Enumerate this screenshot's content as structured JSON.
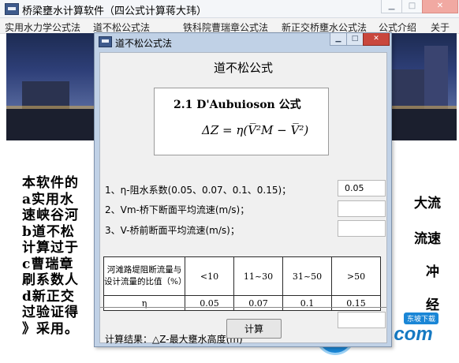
{
  "app": {
    "title": "桥梁壅水计算软件（四公式计算蒋大玮）",
    "menu": [
      "实用水力学公式法",
      "道不松公式法",
      "铁科院曹瑞章公式法",
      "新正交桥壅水公式法",
      "公式介绍",
      "关于"
    ]
  },
  "background": {
    "intro_lines": [
      "本软件的",
      "a实用水",
      "速峡谷河",
      "b道不松",
      "计算过于",
      "c曹瑞章",
      "刷系数人",
      "d新正交",
      "过验证得",
      "》采用。"
    ],
    "right_fragments": [
      "大流",
      "流速",
      "冲",
      "经"
    ]
  },
  "watermark": {
    "text": "uzzf.com",
    "badge": "东坡下载"
  },
  "dialog": {
    "title": "道不松公式法",
    "heading": "道不松公式",
    "formula_title": "2.1  D'Aubuioson 公式",
    "formula": "ΔZ = η(V̅²M − V̅²)",
    "params": [
      {
        "label": "1、η-阻水系数(0.05、0.07、0.1、0.15)；",
        "value": "0.05"
      },
      {
        "label": "2、Vm-桥下断面平均流速(m/s)；",
        "value": ""
      },
      {
        "label": "3、V-桥前断面平均流速(m/s)；",
        "value": ""
      }
    ],
    "table": {
      "header": "河滩路堤阻断流量与设计流量的比值（%）",
      "ranges": [
        "<10",
        "11~30",
        "31~50",
        ">50"
      ],
      "row_label": "η",
      "values": [
        "0.05",
        "0.07",
        "0.1",
        "0.15"
      ]
    },
    "result_label": "计算结果：△Z-最大壅水高度(m)",
    "result_value": "",
    "calc_button": "计算"
  }
}
